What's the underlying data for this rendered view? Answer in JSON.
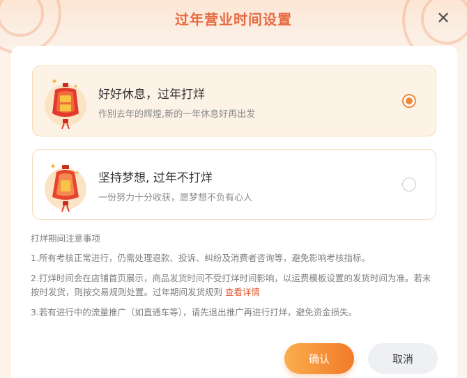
{
  "dialog": {
    "title": "过年营业时间设置",
    "close_icon": "close-icon"
  },
  "options": [
    {
      "title": "好好休息，过年打烊",
      "subtitle": "作别去年的辉煌,新的一年休息好再出发",
      "selected": true,
      "icon": "lantern-icon"
    },
    {
      "title": "坚持梦想, 过年不打烊",
      "subtitle": "一份努力十分收获，愿梦想不负有心人",
      "selected": false,
      "icon": "lantern-icon"
    }
  ],
  "notes": {
    "title": "打烊期间注意事项",
    "items": [
      "1.所有考核正常进行，仍需处理退款、投诉、纠纷及消费者咨询等，避免影响考核指标。",
      "2.打烊时间会在店铺首页展示，商品发货时间不受打烊时间影响，以运费模板设置的发货时间为准。若未按时发货，则按交易规则处置。过年期间发货规则",
      "3.若有进行中的流量推广（如直通车等），请先退出推广再进行打烊，避免资金损失。"
    ],
    "link_text": "查看详情"
  },
  "buttons": {
    "confirm": "确认",
    "cancel": "取消"
  },
  "colors": {
    "accent": "#ee8a39",
    "title": "#e8683f",
    "link": "#e35a32",
    "selected_bg": "#fdf2e6"
  }
}
